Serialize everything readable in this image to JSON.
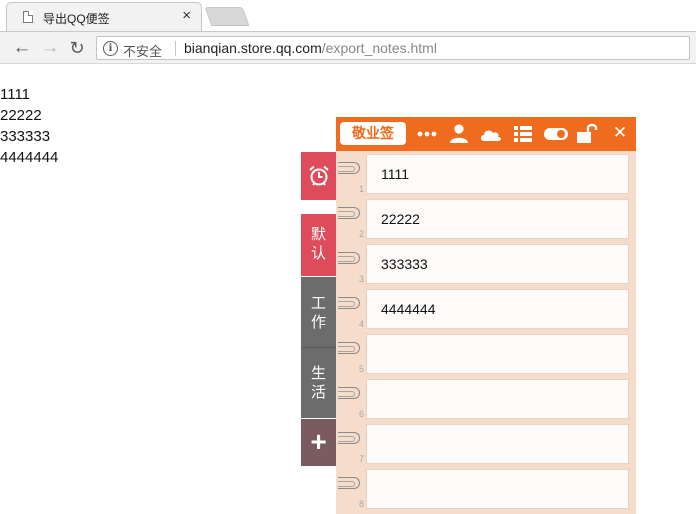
{
  "browser": {
    "tab_title": "导出QQ便签",
    "tab_close": "×",
    "insecure_label": "不安全",
    "url_host": "bianqian.store.qq.com",
    "url_path": "/export_notes.html"
  },
  "page": {
    "lines": [
      "1111",
      "22222",
      "333333",
      "4444444"
    ]
  },
  "widget": {
    "brand_label": "敬业签",
    "header_icons": [
      "more-icon",
      "user-icon",
      "cloud-icon",
      "list-icon",
      "toggle-icon",
      "unlock-icon",
      "close-icon"
    ],
    "close_glyph": "✕",
    "accent_color": "#ef6b1d",
    "side_tabs": {
      "default_label": "默认",
      "work_label": "工作",
      "life_label": "生活",
      "add_label": "+"
    },
    "notes": [
      {
        "number": "1",
        "text": "1111"
      },
      {
        "number": "2",
        "text": "22222"
      },
      {
        "number": "3",
        "text": "333333"
      },
      {
        "number": "4",
        "text": "4444444"
      },
      {
        "number": "5",
        "text": ""
      },
      {
        "number": "6",
        "text": ""
      },
      {
        "number": "7",
        "text": ""
      },
      {
        "number": "8",
        "text": ""
      }
    ]
  }
}
